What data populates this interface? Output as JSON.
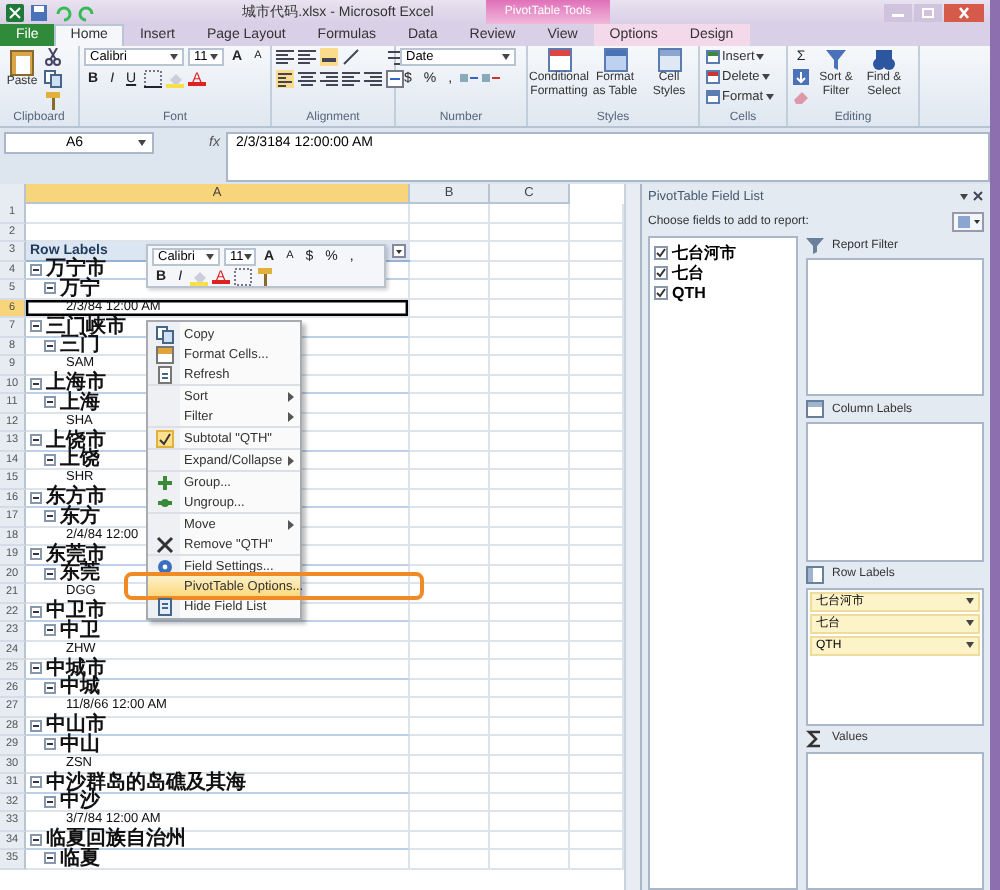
{
  "window": {
    "title": "城市代码.xlsx - Microsoft Excel",
    "contextual_header": "PivotTable Tools"
  },
  "tabs": [
    {
      "label": "File",
      "kind": "file",
      "selected": false
    },
    {
      "label": "Home",
      "kind": "normal",
      "selected": true
    },
    {
      "label": "Insert",
      "kind": "normal",
      "selected": false
    },
    {
      "label": "Page Layout",
      "kind": "normal",
      "selected": false
    },
    {
      "label": "Formulas",
      "kind": "normal",
      "selected": false
    },
    {
      "label": "Data",
      "kind": "normal",
      "selected": false
    },
    {
      "label": "Review",
      "kind": "normal",
      "selected": false
    },
    {
      "label": "View",
      "kind": "normal",
      "selected": false
    },
    {
      "label": "Options",
      "kind": "contextual",
      "selected": false
    },
    {
      "label": "Design",
      "kind": "contextual",
      "selected": false
    }
  ],
  "ribbon": {
    "clipboard": {
      "label": "Clipboard",
      "paste": "Paste"
    },
    "font": {
      "label": "Font",
      "font_name": "Calibri",
      "font_size": "11",
      "grow": "A",
      "shrink": "A",
      "bold": "B",
      "italic": "I",
      "underline": "U",
      "font_color": "A"
    },
    "alignment": {
      "label": "Alignment"
    },
    "number": {
      "label": "Number",
      "format": "Date",
      "currency": "$",
      "percent": "%",
      "comma": ","
    },
    "styles": {
      "label": "Styles",
      "buttons": [
        "Conditional Formatting",
        "Format as Table",
        "Cell Styles"
      ]
    },
    "cells": {
      "label": "Cells",
      "buttons": [
        "Insert",
        "Delete",
        "Format"
      ]
    },
    "editing": {
      "label": "Editing",
      "sum": "Σ",
      "buttons": [
        "Sort & Filter",
        "Find & Select"
      ]
    }
  },
  "formula_bar": {
    "name_box": "A6",
    "fx": "fx",
    "value": "2/3/3184  12:00:00 AM"
  },
  "columns": [
    {
      "label": "A",
      "selected": true
    },
    {
      "label": "B",
      "selected": false
    },
    {
      "label": "C",
      "selected": false
    }
  ],
  "row_numbers": [
    "1",
    "2",
    "3",
    "4",
    "5",
    "6",
    "7",
    "8",
    "9",
    "10",
    "11",
    "12",
    "13",
    "14",
    "15",
    "16",
    "17",
    "18",
    "19",
    "20",
    "21",
    "22",
    "23",
    "24",
    "25",
    "26",
    "27",
    "28",
    "29",
    "30",
    "31",
    "32",
    "33",
    "34",
    "35"
  ],
  "pivot_header": "Row Labels",
  "pivot_rows": [
    {
      "label": "万宁市",
      "expanded": true,
      "selected": false,
      "children": [
        {
          "label": "万宁",
          "expanded": true,
          "selected": false,
          "children": [
            {
              "label": "2/3/84 12:00 AM",
              "selected": true
            }
          ]
        }
      ]
    },
    {
      "label": "三门峡市",
      "expanded": true,
      "selected": false,
      "children": [
        {
          "label": "三门",
          "expanded": true,
          "selected": false,
          "children": [
            {
              "label": "SAM",
              "selected": false
            }
          ]
        }
      ]
    },
    {
      "label": "上海市",
      "expanded": true,
      "selected": false,
      "children": [
        {
          "label": "上海",
          "expanded": true,
          "selected": false,
          "children": [
            {
              "label": "SHA",
              "selected": false
            }
          ]
        }
      ]
    },
    {
      "label": "上饶市",
      "expanded": true,
      "selected": false,
      "children": [
        {
          "label": "上饶",
          "expanded": true,
          "selected": false,
          "children": [
            {
              "label": "SHR",
              "selected": false
            }
          ]
        }
      ]
    },
    {
      "label": "东方市",
      "expanded": true,
      "selected": false,
      "children": [
        {
          "label": "东方",
          "expanded": true,
          "selected": false,
          "children": [
            {
              "label": "2/4/84 12:00",
              "selected": false
            }
          ]
        }
      ]
    },
    {
      "label": "东莞市",
      "expanded": true,
      "selected": false,
      "children": [
        {
          "label": "东莞",
          "expanded": true,
          "selected": false,
          "children": [
            {
              "label": "DGG",
              "selected": false
            }
          ]
        }
      ]
    },
    {
      "label": "中卫市",
      "expanded": true,
      "selected": false,
      "children": [
        {
          "label": "中卫",
          "expanded": true,
          "selected": false,
          "children": [
            {
              "label": "ZHW",
              "selected": false
            }
          ]
        }
      ]
    },
    {
      "label": "中城市",
      "expanded": true,
      "selected": false,
      "children": [
        {
          "label": "中城",
          "expanded": true,
          "selected": false,
          "children": [
            {
              "label": "11/8/66 12:00 AM",
              "selected": false
            }
          ]
        }
      ]
    },
    {
      "label": "中山市",
      "expanded": true,
      "selected": false,
      "children": [
        {
          "label": "中山",
          "expanded": true,
          "selected": false,
          "children": [
            {
              "label": "ZSN",
              "selected": false
            }
          ]
        }
      ]
    },
    {
      "label": "中沙群岛的岛礁及其海",
      "expanded": true,
      "selected": false,
      "children": [
        {
          "label": "中沙",
          "expanded": true,
          "selected": false,
          "children": [
            {
              "label": "3/7/84 12:00 AM",
              "selected": false
            }
          ]
        }
      ]
    },
    {
      "label": "临夏回族自治州",
      "expanded": true,
      "selected": false,
      "children": [
        {
          "label": "临夏",
          "expanded": true,
          "selected": false
        }
      ]
    }
  ],
  "mini_toolbar": {
    "font_name": "Calibri",
    "font_size": "11",
    "grow": "A",
    "shrink": "A",
    "currency": "$",
    "percent": "%",
    "comma": ",",
    "bold": "B",
    "italic": "I",
    "font_color": "A"
  },
  "context_menu": [
    {
      "label": "Copy",
      "checked": false,
      "submenu": false,
      "separator_before": false,
      "highlighted": false
    },
    {
      "label": "Format Cells...",
      "checked": false,
      "submenu": false,
      "separator_before": false,
      "highlighted": false
    },
    {
      "label": "Refresh",
      "checked": false,
      "submenu": false,
      "separator_before": false,
      "highlighted": false
    },
    {
      "label": "Sort",
      "checked": false,
      "submenu": true,
      "separator_before": true,
      "highlighted": false
    },
    {
      "label": "Filter",
      "checked": false,
      "submenu": true,
      "separator_before": false,
      "highlighted": false
    },
    {
      "label": "Subtotal \"QTH\"",
      "checked": true,
      "submenu": false,
      "separator_before": true,
      "highlighted": false
    },
    {
      "label": "Expand/Collapse",
      "checked": false,
      "submenu": true,
      "separator_before": true,
      "highlighted": false
    },
    {
      "label": "Group...",
      "checked": false,
      "submenu": false,
      "separator_before": true,
      "highlighted": false
    },
    {
      "label": "Ungroup...",
      "checked": false,
      "submenu": false,
      "separator_before": false,
      "highlighted": false
    },
    {
      "label": "Move",
      "checked": false,
      "submenu": true,
      "separator_before": true,
      "highlighted": false
    },
    {
      "label": "Remove \"QTH\"",
      "checked": false,
      "submenu": false,
      "separator_before": false,
      "highlighted": false
    },
    {
      "label": "Field Settings...",
      "checked": false,
      "submenu": false,
      "separator_before": true,
      "highlighted": false
    },
    {
      "label": "PivotTable Options...",
      "checked": false,
      "submenu": false,
      "separator_before": false,
      "highlighted": true
    },
    {
      "label": "Hide Field List",
      "checked": false,
      "submenu": false,
      "separator_before": false,
      "highlighted": false
    }
  ],
  "field_list": {
    "title": "PivotTable Field List",
    "prompt": "Choose fields to add to report:",
    "fields": [
      {
        "label": "七台河市",
        "checked": true
      },
      {
        "label": "七台",
        "checked": true
      },
      {
        "label": "QTH",
        "checked": true
      }
    ],
    "areas": [
      {
        "label": "Report Filter",
        "kind": "filter"
      },
      {
        "label": "Column Labels",
        "kind": "columns"
      },
      {
        "label": "Row Labels",
        "kind": "rows",
        "items": [
          "七台河市",
          "七台",
          "QTH"
        ]
      },
      {
        "label": "Values",
        "kind": "values"
      }
    ]
  }
}
